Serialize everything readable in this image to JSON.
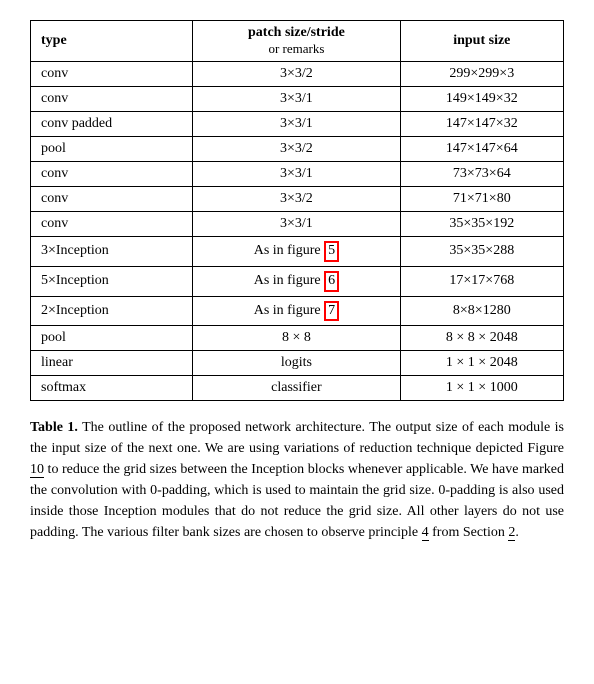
{
  "table": {
    "headers": [
      {
        "id": "type",
        "label": "type"
      },
      {
        "id": "patch",
        "label": "patch size/stride",
        "sub": "or remarks"
      },
      {
        "id": "input",
        "label": "input size"
      }
    ],
    "rows": [
      {
        "type": "conv",
        "patch": "3×3/2",
        "input": "299×299×3"
      },
      {
        "type": "conv",
        "patch": "3×3/1",
        "input": "149×149×32"
      },
      {
        "type": "conv padded",
        "patch": "3×3/1",
        "input": "147×147×32"
      },
      {
        "type": "pool",
        "patch": "3×3/2",
        "input": "147×147×64"
      },
      {
        "type": "conv",
        "patch": "3×3/1",
        "input": "73×73×64"
      },
      {
        "type": "conv",
        "patch": "3×3/2",
        "input": "71×71×80"
      },
      {
        "type": "conv",
        "patch": "3×3/1",
        "input": "35×35×192"
      },
      {
        "type": "3×Inception",
        "patch": "As in figure 5",
        "input": "35×35×288",
        "patchRedBox": "5"
      },
      {
        "type": "5×Inception",
        "patch": "As in figure 6",
        "input": "17×17×768",
        "patchRedBox": "6"
      },
      {
        "type": "2×Inception",
        "patch": "As in figure 7",
        "input": "8×8×1280",
        "patchRedBox": "7"
      },
      {
        "type": "pool",
        "patch": "8 × 8",
        "input": "8 × 8 × 2048"
      },
      {
        "type": "linear",
        "patch": "logits",
        "input": "1 × 1 × 2048"
      },
      {
        "type": "softmax",
        "patch": "classifier",
        "input": "1 × 1 × 1000"
      }
    ]
  },
  "caption": {
    "label": "Table 1.",
    "text": " The outline of the proposed network architecture.  The output size of each module is the input size of the next one.  We are using variations of reduction technique depicted Figure ",
    "ref10": "10",
    "text2": " to reduce the grid sizes between the Inception blocks whenever applicable.  We have marked the convolution with 0-padding, which is used to maintain the grid size.  0-padding is also used inside those Inception modules that do not reduce the grid size.  All other layers do not use padding.  The various filter bank sizes are chosen to observe principle ",
    "ref4": "4",
    "text3": " from Section ",
    "ref2": "2",
    "text4": "."
  }
}
